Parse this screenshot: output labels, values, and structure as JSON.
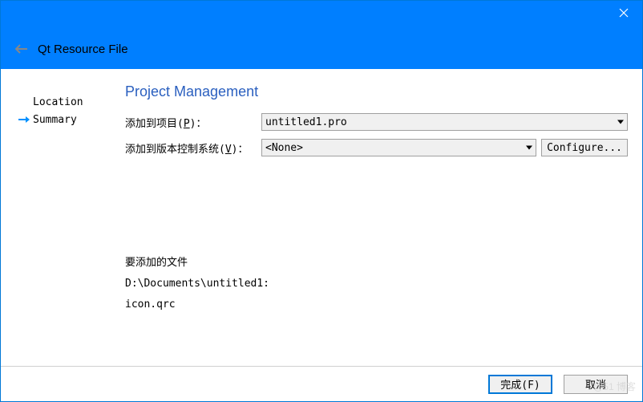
{
  "header": {
    "title": "Qt Resource File"
  },
  "sidebar": {
    "items": [
      {
        "label": "Location",
        "active": false
      },
      {
        "label": "Summary",
        "active": true
      }
    ]
  },
  "main": {
    "page_title": "Project Management",
    "project_label_prefix": "添加到项目(",
    "project_label_key": "P",
    "project_label_suffix": ")：",
    "project_value": "untitled1.pro",
    "vcs_label_prefix": "添加到版本控制系统(",
    "vcs_label_key": "V",
    "vcs_label_suffix": ")：",
    "vcs_value": "<None>",
    "configure_label": "Configure...",
    "files_heading": "要添加的文件",
    "files_path": "D:\\Documents\\untitled1:",
    "files_list": "icon.qrc"
  },
  "footer": {
    "finish_label": "完成(F)",
    "cancel_label": "取消"
  },
  "watermark": "@51 博客"
}
